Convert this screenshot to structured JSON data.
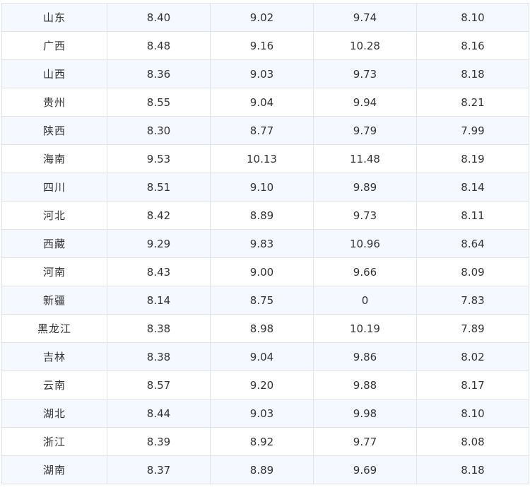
{
  "table": {
    "rows": [
      {
        "region": "山东",
        "v1": "8.40",
        "v2": "9.02",
        "v3": "9.74",
        "v4": "8.10"
      },
      {
        "region": "广西",
        "v1": "8.48",
        "v2": "9.16",
        "v3": "10.28",
        "v4": "8.16"
      },
      {
        "region": "山西",
        "v1": "8.36",
        "v2": "9.03",
        "v3": "9.73",
        "v4": "8.18"
      },
      {
        "region": "贵州",
        "v1": "8.55",
        "v2": "9.04",
        "v3": "9.94",
        "v4": "8.21"
      },
      {
        "region": "陕西",
        "v1": "8.30",
        "v2": "8.77",
        "v3": "9.79",
        "v4": "7.99"
      },
      {
        "region": "海南",
        "v1": "9.53",
        "v2": "10.13",
        "v3": "11.48",
        "v4": "8.19"
      },
      {
        "region": "四川",
        "v1": "8.51",
        "v2": "9.10",
        "v3": "9.89",
        "v4": "8.14"
      },
      {
        "region": "河北",
        "v1": "8.42",
        "v2": "8.89",
        "v3": "9.73",
        "v4": "8.11"
      },
      {
        "region": "西藏",
        "v1": "9.29",
        "v2": "9.83",
        "v3": "10.96",
        "v4": "8.64"
      },
      {
        "region": "河南",
        "v1": "8.43",
        "v2": "9.00",
        "v3": "9.66",
        "v4": "8.09"
      },
      {
        "region": "新疆",
        "v1": "8.14",
        "v2": "8.75",
        "v3": "0",
        "v4": "7.83"
      },
      {
        "region": "黑龙江",
        "v1": "8.38",
        "v2": "8.98",
        "v3": "10.19",
        "v4": "7.89"
      },
      {
        "region": "吉林",
        "v1": "8.38",
        "v2": "9.04",
        "v3": "9.86",
        "v4": "8.02"
      },
      {
        "region": "云南",
        "v1": "8.57",
        "v2": "9.20",
        "v3": "9.88",
        "v4": "8.17"
      },
      {
        "region": "湖北",
        "v1": "8.44",
        "v2": "9.03",
        "v3": "9.98",
        "v4": "8.10"
      },
      {
        "region": "浙江",
        "v1": "8.39",
        "v2": "8.92",
        "v3": "9.77",
        "v4": "8.08"
      },
      {
        "region": "湖南",
        "v1": "8.37",
        "v2": "8.89",
        "v3": "9.69",
        "v4": "8.18"
      }
    ]
  },
  "colors": {
    "row_alt_bg": "#f5f8ff",
    "row_bg": "#ffffff",
    "border": "#dfe3ea",
    "text": "#333333"
  }
}
